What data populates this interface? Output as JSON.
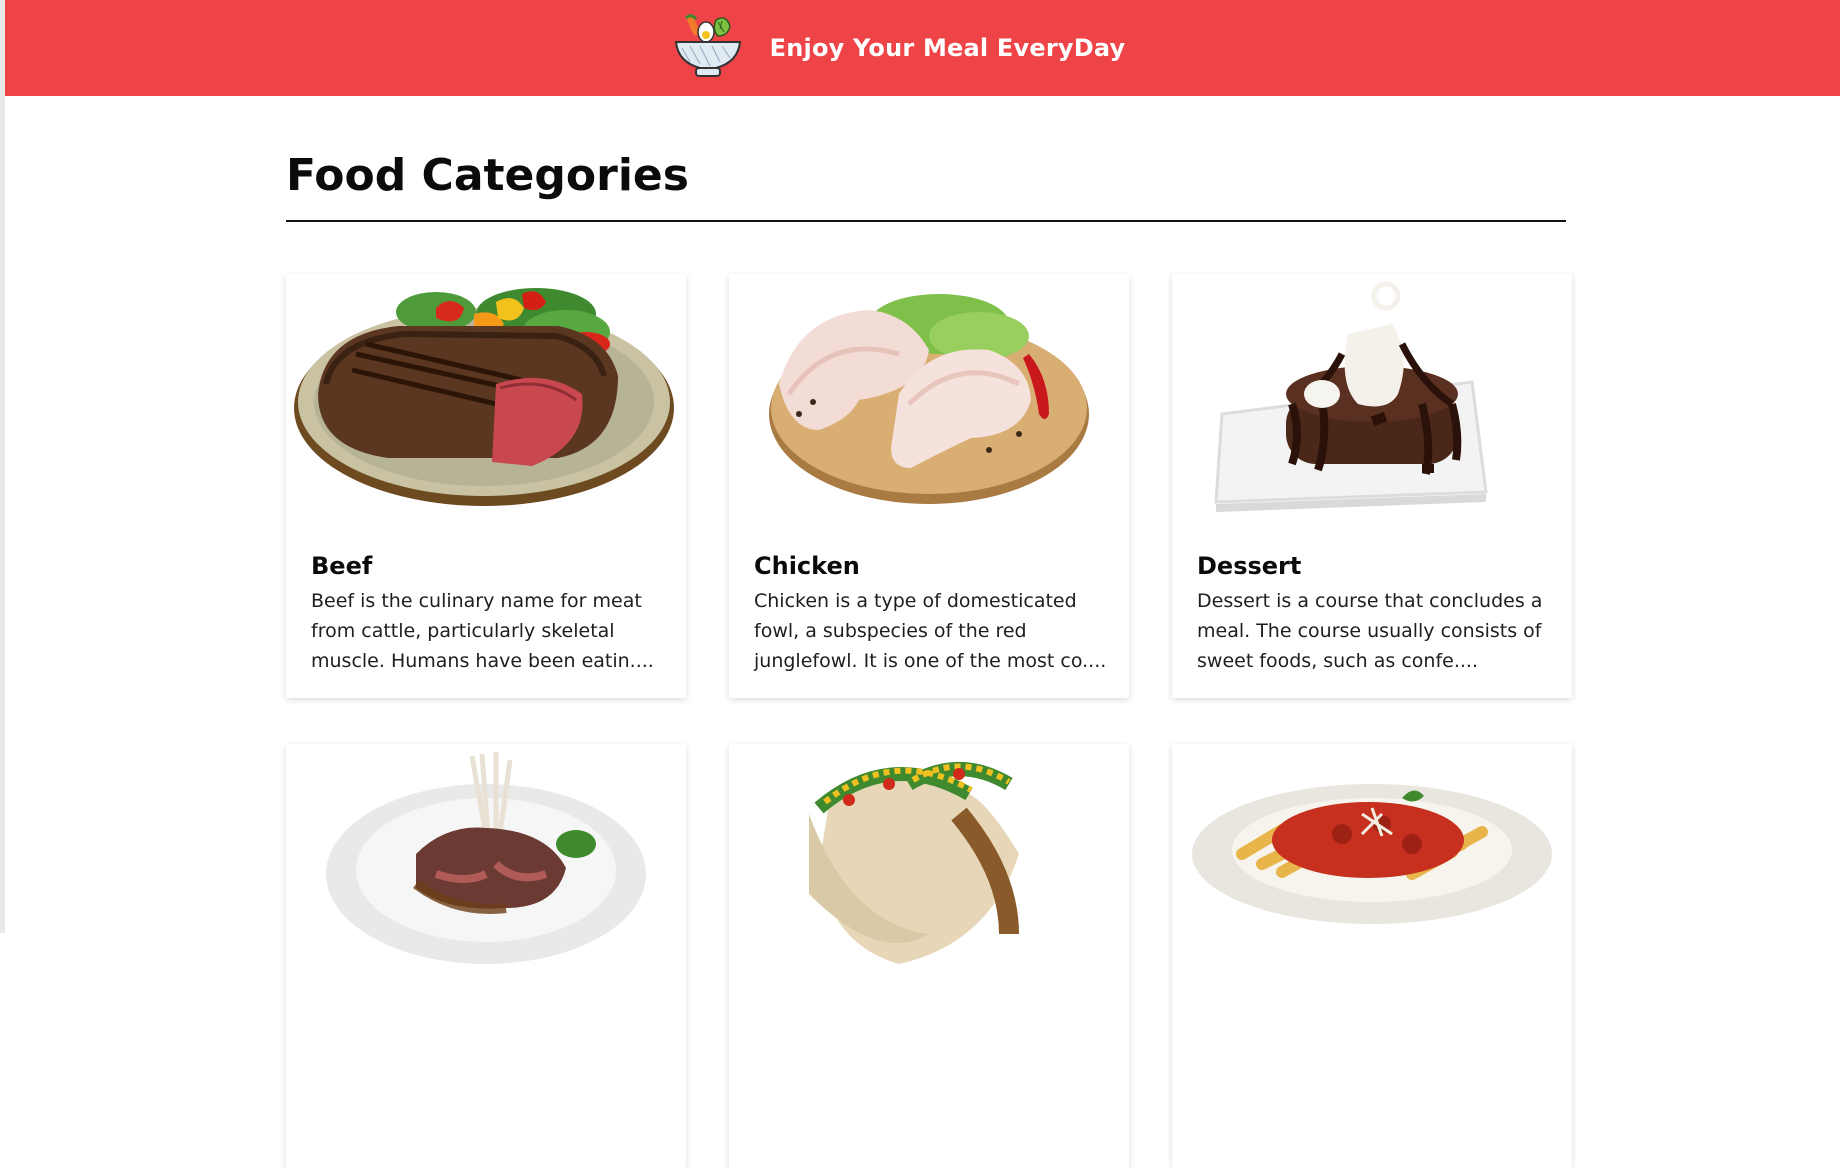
{
  "header": {
    "logo_icon": "salad-bowl-icon",
    "title": "Enjoy Your Meal EveryDay",
    "background_color": "#ef4447"
  },
  "main": {
    "title": "Food Categories",
    "categories": [
      {
        "name": "Beef",
        "description": "Beef is the culinary name for meat from cattle, particularly skeletal muscle. Humans have been eatin....",
        "image_icon": "steak-plate-image"
      },
      {
        "name": "Chicken",
        "description": "Chicken is a type of domesticated fowl, a subspecies of the red junglefowl. It is one of the most co....",
        "image_icon": "chicken-legs-image"
      },
      {
        "name": "Dessert",
        "description": "Dessert is a course that concludes a meal. The course usually consists of sweet foods, such as confe....",
        "image_icon": "chocolate-cake-image"
      },
      {
        "name": "",
        "description": "",
        "image_icon": "lamb-chops-image"
      },
      {
        "name": "",
        "description": "",
        "image_icon": "tacos-image"
      },
      {
        "name": "",
        "description": "",
        "image_icon": "pasta-plate-image"
      }
    ]
  }
}
